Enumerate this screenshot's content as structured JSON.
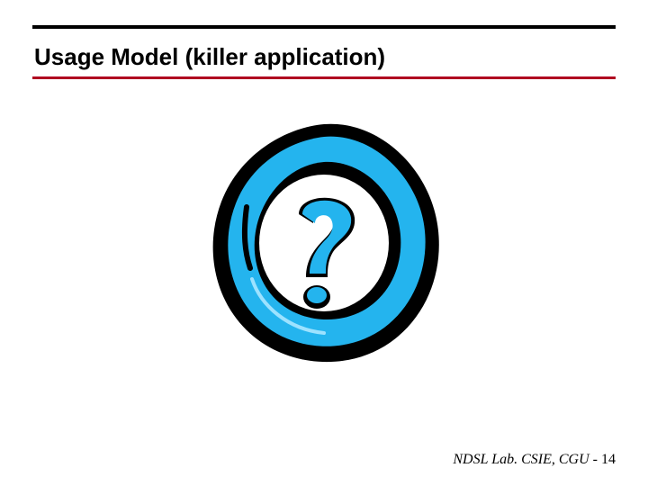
{
  "title": "Usage Model (killer application)",
  "icon_name": "question-mark-circle-icon",
  "footer": {
    "text": "NDSL Lab. CSIE, CGU ",
    "separator": "- ",
    "page": "14"
  },
  "colors": {
    "accent": "#00a2e8",
    "underline": "#b00020"
  }
}
